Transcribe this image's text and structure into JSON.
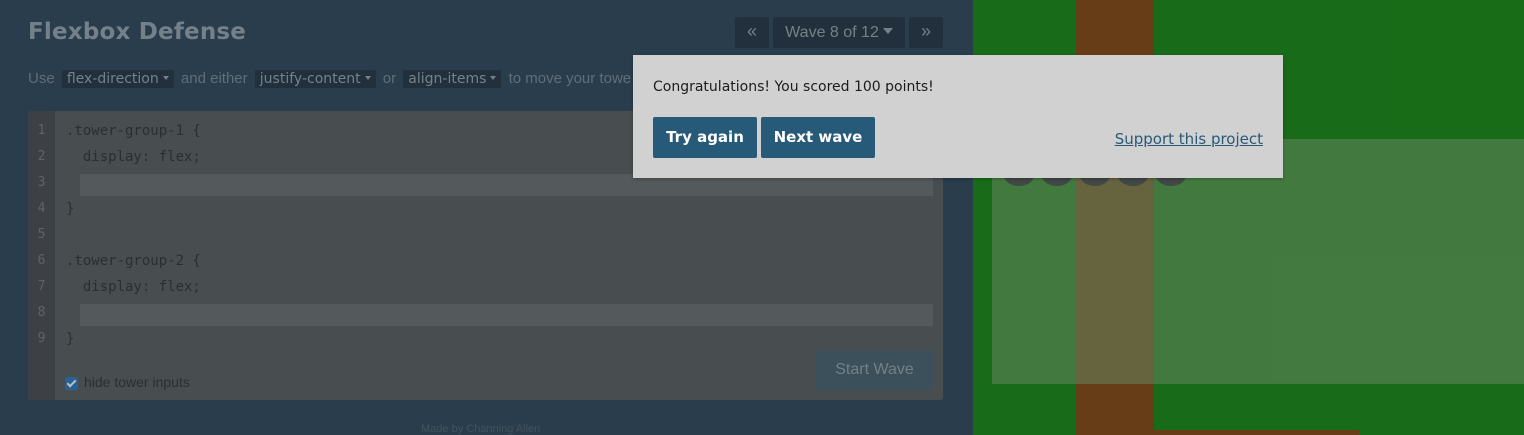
{
  "header": {
    "title": "Flexbox Defense",
    "wave_prev_glyph": "«",
    "wave_label": "Wave 8 of 12",
    "wave_next_glyph": "»"
  },
  "instructions": {
    "prefix": "Use",
    "property_1": "flex-direction",
    "connector": "and either",
    "property_2": "justify-content",
    "or_word": "or",
    "property_3": "align-items",
    "suffix": "to move your towe"
  },
  "editor": {
    "line_numbers": [
      "1",
      "2",
      "3",
      "4",
      "5",
      "6",
      "7",
      "8",
      "9"
    ],
    "line_1": ".tower-group-1 {",
    "line_2": "  display: flex;",
    "line_4": "}",
    "line_6": ".tower-group-2 {",
    "line_7": "  display: flex;",
    "line_9": "}",
    "input_1_value": "",
    "input_2_value": "",
    "start_wave_label": "Start Wave",
    "hide_inputs_label": "hide tower inputs",
    "hide_inputs_checked": true
  },
  "footer": {
    "credit": "Made by Channing Allen"
  },
  "dialog": {
    "message": "Congratulations! You scored 100 points!",
    "try_again_label": "Try again",
    "next_wave_label": "Next wave",
    "support_label": "Support this project"
  },
  "colors": {
    "accent": "#275a78",
    "board_green": "#008000",
    "path_brown": "#7a3a00"
  }
}
